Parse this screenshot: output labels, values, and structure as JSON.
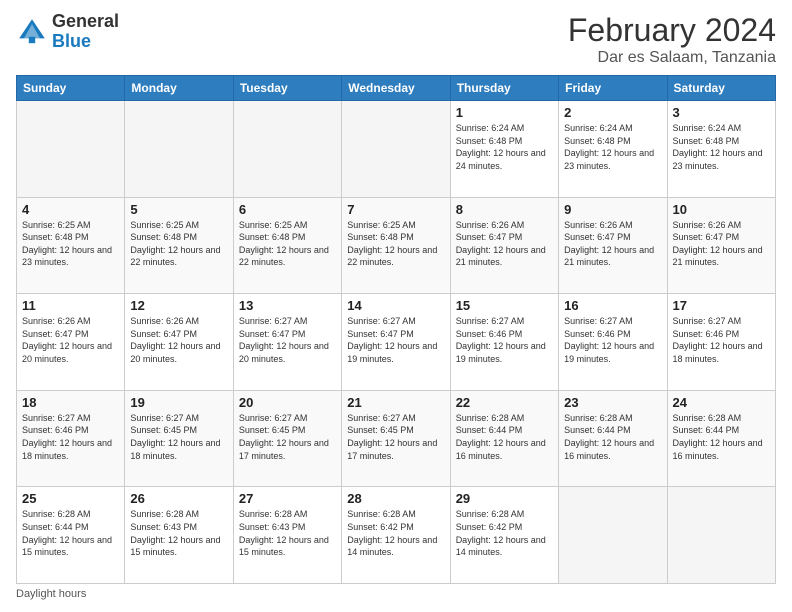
{
  "header": {
    "logo_general": "General",
    "logo_blue": "Blue",
    "month_title": "February 2024",
    "subtitle": "Dar es Salaam, Tanzania"
  },
  "footer": {
    "label": "Daylight hours"
  },
  "days_of_week": [
    "Sunday",
    "Monday",
    "Tuesday",
    "Wednesday",
    "Thursday",
    "Friday",
    "Saturday"
  ],
  "weeks": [
    [
      {
        "day": "",
        "info": ""
      },
      {
        "day": "",
        "info": ""
      },
      {
        "day": "",
        "info": ""
      },
      {
        "day": "",
        "info": ""
      },
      {
        "day": "1",
        "info": "Sunrise: 6:24 AM\nSunset: 6:48 PM\nDaylight: 12 hours and 24 minutes."
      },
      {
        "day": "2",
        "info": "Sunrise: 6:24 AM\nSunset: 6:48 PM\nDaylight: 12 hours and 23 minutes."
      },
      {
        "day": "3",
        "info": "Sunrise: 6:24 AM\nSunset: 6:48 PM\nDaylight: 12 hours and 23 minutes."
      }
    ],
    [
      {
        "day": "4",
        "info": "Sunrise: 6:25 AM\nSunset: 6:48 PM\nDaylight: 12 hours and 23 minutes."
      },
      {
        "day": "5",
        "info": "Sunrise: 6:25 AM\nSunset: 6:48 PM\nDaylight: 12 hours and 22 minutes."
      },
      {
        "day": "6",
        "info": "Sunrise: 6:25 AM\nSunset: 6:48 PM\nDaylight: 12 hours and 22 minutes."
      },
      {
        "day": "7",
        "info": "Sunrise: 6:25 AM\nSunset: 6:48 PM\nDaylight: 12 hours and 22 minutes."
      },
      {
        "day": "8",
        "info": "Sunrise: 6:26 AM\nSunset: 6:47 PM\nDaylight: 12 hours and 21 minutes."
      },
      {
        "day": "9",
        "info": "Sunrise: 6:26 AM\nSunset: 6:47 PM\nDaylight: 12 hours and 21 minutes."
      },
      {
        "day": "10",
        "info": "Sunrise: 6:26 AM\nSunset: 6:47 PM\nDaylight: 12 hours and 21 minutes."
      }
    ],
    [
      {
        "day": "11",
        "info": "Sunrise: 6:26 AM\nSunset: 6:47 PM\nDaylight: 12 hours and 20 minutes."
      },
      {
        "day": "12",
        "info": "Sunrise: 6:26 AM\nSunset: 6:47 PM\nDaylight: 12 hours and 20 minutes."
      },
      {
        "day": "13",
        "info": "Sunrise: 6:27 AM\nSunset: 6:47 PM\nDaylight: 12 hours and 20 minutes."
      },
      {
        "day": "14",
        "info": "Sunrise: 6:27 AM\nSunset: 6:47 PM\nDaylight: 12 hours and 19 minutes."
      },
      {
        "day": "15",
        "info": "Sunrise: 6:27 AM\nSunset: 6:46 PM\nDaylight: 12 hours and 19 minutes."
      },
      {
        "day": "16",
        "info": "Sunrise: 6:27 AM\nSunset: 6:46 PM\nDaylight: 12 hours and 19 minutes."
      },
      {
        "day": "17",
        "info": "Sunrise: 6:27 AM\nSunset: 6:46 PM\nDaylight: 12 hours and 18 minutes."
      }
    ],
    [
      {
        "day": "18",
        "info": "Sunrise: 6:27 AM\nSunset: 6:46 PM\nDaylight: 12 hours and 18 minutes."
      },
      {
        "day": "19",
        "info": "Sunrise: 6:27 AM\nSunset: 6:45 PM\nDaylight: 12 hours and 18 minutes."
      },
      {
        "day": "20",
        "info": "Sunrise: 6:27 AM\nSunset: 6:45 PM\nDaylight: 12 hours and 17 minutes."
      },
      {
        "day": "21",
        "info": "Sunrise: 6:27 AM\nSunset: 6:45 PM\nDaylight: 12 hours and 17 minutes."
      },
      {
        "day": "22",
        "info": "Sunrise: 6:28 AM\nSunset: 6:44 PM\nDaylight: 12 hours and 16 minutes."
      },
      {
        "day": "23",
        "info": "Sunrise: 6:28 AM\nSunset: 6:44 PM\nDaylight: 12 hours and 16 minutes."
      },
      {
        "day": "24",
        "info": "Sunrise: 6:28 AM\nSunset: 6:44 PM\nDaylight: 12 hours and 16 minutes."
      }
    ],
    [
      {
        "day": "25",
        "info": "Sunrise: 6:28 AM\nSunset: 6:44 PM\nDaylight: 12 hours and 15 minutes."
      },
      {
        "day": "26",
        "info": "Sunrise: 6:28 AM\nSunset: 6:43 PM\nDaylight: 12 hours and 15 minutes."
      },
      {
        "day": "27",
        "info": "Sunrise: 6:28 AM\nSunset: 6:43 PM\nDaylight: 12 hours and 15 minutes."
      },
      {
        "day": "28",
        "info": "Sunrise: 6:28 AM\nSunset: 6:42 PM\nDaylight: 12 hours and 14 minutes."
      },
      {
        "day": "29",
        "info": "Sunrise: 6:28 AM\nSunset: 6:42 PM\nDaylight: 12 hours and 14 minutes."
      },
      {
        "day": "",
        "info": ""
      },
      {
        "day": "",
        "info": ""
      }
    ]
  ]
}
